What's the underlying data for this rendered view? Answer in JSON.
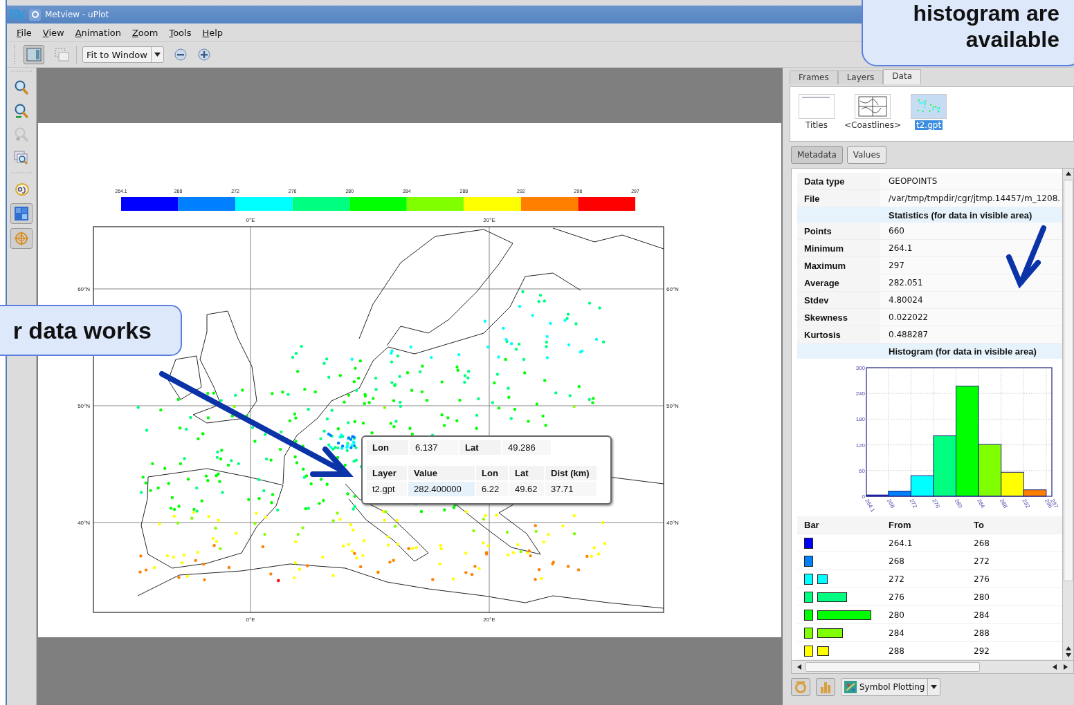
{
  "window": {
    "title": "Metview - uPlot"
  },
  "menu": [
    "File",
    "View",
    "Animation",
    "Zoom",
    "Tools",
    "Help"
  ],
  "toolbar": {
    "layout_pressed": true,
    "zoom_mode": "Fit to Window"
  },
  "side_tools": [
    {
      "kind": "zoom_in",
      "pressed": false,
      "disabled": false
    },
    {
      "kind": "zoom_out",
      "pressed": false,
      "disabled": false
    },
    {
      "kind": "zoom_select",
      "pressed": false,
      "disabled": true
    },
    {
      "kind": "zoom_stack",
      "pressed": false,
      "disabled": false
    },
    {
      "kind": "label",
      "pressed": false,
      "disabled": false
    },
    {
      "kind": "grid",
      "pressed": true,
      "disabled": false
    },
    {
      "kind": "crosshair",
      "pressed": true,
      "disabled": false
    }
  ],
  "plot": {
    "colorbar": {
      "ticks": [
        "264.1",
        "268",
        "272",
        "276",
        "280",
        "284",
        "288",
        "292",
        "296",
        "297"
      ],
      "segments": [
        {
          "color": "#0000ff"
        },
        {
          "color": "#0080ff"
        },
        {
          "color": "#00ffff"
        },
        {
          "color": "#00ff80"
        },
        {
          "color": "#00ff00"
        },
        {
          "color": "#80ff00"
        },
        {
          "color": "#ffff00"
        },
        {
          "color": "#ff8000"
        },
        {
          "color": "#ff0000"
        }
      ]
    },
    "top_labels": [
      "0°E",
      "20°E"
    ],
    "bottom_labels": [
      "0°E",
      "20°E"
    ],
    "left_labels": [
      "60°N",
      "50°N",
      "40°N"
    ],
    "right_labels": [
      "60°N",
      "50°N",
      "40°N"
    ]
  },
  "tooltip": {
    "lon_label": "Lon",
    "lon": "6.137",
    "lat_label": "Lat",
    "lat": "49.286",
    "columns": [
      "Layer",
      "Value",
      "Lon",
      "Lat",
      "Dist (km)"
    ],
    "row": [
      "t2.gpt",
      "282.400000",
      "6.22",
      "49.62",
      "37.71"
    ]
  },
  "panel": {
    "tabs": [
      {
        "label": "Frames",
        "selected": false
      },
      {
        "label": "Layers",
        "selected": false
      },
      {
        "label": "Data",
        "selected": true
      }
    ],
    "layers": [
      {
        "name": "Titles",
        "kind": "titles",
        "selected": false
      },
      {
        "name": "<Coastlines>",
        "kind": "coastlines",
        "selected": false
      },
      {
        "name": "t2.gpt",
        "kind": "points",
        "selected": true
      }
    ],
    "views": [
      {
        "label": "Metadata",
        "selected": true
      },
      {
        "label": "Values",
        "selected": false
      }
    ],
    "metadata": [
      {
        "kind": "row",
        "label": "Data type",
        "value": "GEOPOINTS"
      },
      {
        "kind": "row",
        "label": "File",
        "value": "/var/tmp/tmpdir/cgr/jtmp.14457/m_1208."
      },
      {
        "kind": "section",
        "label": "Statistics (for data in visible area)"
      },
      {
        "kind": "row",
        "label": "Points",
        "value": "660"
      },
      {
        "kind": "row",
        "label": "Minimum",
        "value": "264.1"
      },
      {
        "kind": "row",
        "label": "Maximum",
        "value": "297"
      },
      {
        "kind": "row",
        "label": "Average",
        "value": "282.051"
      },
      {
        "kind": "row",
        "label": "Stdev",
        "value": "4.80024"
      },
      {
        "kind": "row",
        "label": "Skewness",
        "value": "0.022022"
      },
      {
        "kind": "row",
        "label": "Kurtosis",
        "value": "0.488287"
      },
      {
        "kind": "section",
        "label": "Histogram (for data in visible area)"
      }
    ],
    "histogram": {
      "chart_data": {
        "type": "bar",
        "x": [
          266.05,
          270,
          274,
          278,
          282,
          286,
          290,
          294
        ],
        "series": [
          {
            "values": [
              3,
              12,
              48,
              141,
              257,
              121,
              56,
              15
            ]
          }
        ],
        "xlim": [
          264.1,
          297
        ],
        "ylim": [
          0,
          300
        ],
        "yticks": [
          0,
          60,
          120,
          180,
          240,
          300
        ],
        "xticks": [
          264.1,
          268,
          272,
          276,
          280,
          284,
          288,
          292,
          296,
          297
        ],
        "grid": true
      }
    },
    "bins": {
      "columns": [
        "Bar",
        "From",
        "To"
      ],
      "rows": [
        {
          "color": "#0000ff",
          "from": "264.1",
          "to": "268"
        },
        {
          "color": "#0080ff",
          "from": "268",
          "to": "272"
        },
        {
          "color": "#00ffff",
          "from": "272",
          "to": "276"
        },
        {
          "color": "#00ff80",
          "from": "276",
          "to": "280"
        },
        {
          "color": "#00ff00",
          "from": "280",
          "to": "284"
        },
        {
          "color": "#80ff00",
          "from": "284",
          "to": "288"
        },
        {
          "color": "#ffff00",
          "from": "288",
          "to": "292"
        }
      ]
    },
    "plotting": "Symbol Plotting"
  },
  "callouts": [
    {
      "lines": [
        "histogram are",
        "available"
      ]
    },
    {
      "lines": [
        "r data works"
      ]
    }
  ]
}
